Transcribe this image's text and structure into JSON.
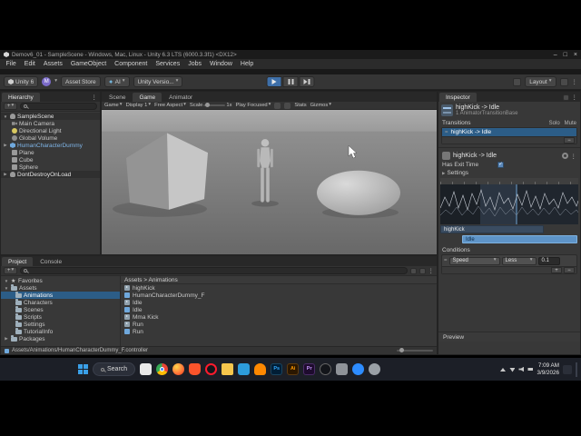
{
  "glyphs": {
    "caret": "▾",
    "fold_open": "▼",
    "fold_closed": "▶",
    "dots": "⋮",
    "check": "✓",
    "star": "★",
    "plus": "+",
    "minus": "−",
    "equals": "=",
    "minimize": "–",
    "maximize": "□",
    "close": "×"
  },
  "titlebar": {
    "title": "Demov6_01 - SampleScene - Windows, Mac, Linux - Unity 6.3 LTS (6000.3.3f1) <DX12>"
  },
  "menubar": {
    "items": [
      "File",
      "Edit",
      "Assets",
      "GameObject",
      "Component",
      "Services",
      "Jobs",
      "Window",
      "Help"
    ]
  },
  "toolbar": {
    "unity_badge": "Unity 6",
    "account": "M",
    "asset_store": "Asset Store",
    "ai": "AI",
    "version": "Unity Versio...",
    "layout": "Layout"
  },
  "hierarchy": {
    "tab": "Hierarchy",
    "scene": "SampleScene",
    "items": [
      "Main Camera",
      "Directional Light",
      "Global Volume",
      "HumanCharacterDummy",
      "Plane",
      "Cube",
      "Sphere"
    ],
    "dont_destroy": "DontDestroyOnLoad"
  },
  "gameview": {
    "tabs": [
      "Scene",
      "Game",
      "Animator"
    ],
    "menu": "Game",
    "display": "Display 1",
    "aspect": "Free Aspect",
    "scale_label": "Scale",
    "scale_value": "1x",
    "play_focused": "Play Focused",
    "stats": "Stats",
    "gizmos": "Gizmos"
  },
  "inspector": {
    "tab": "Inspector",
    "header": {
      "title": "highKick -> Idle",
      "subtitle": "1 AnimatorTransitionBase"
    },
    "transitions_label": "Transitions",
    "solo": "Solo",
    "mute": "Mute",
    "transition_item": "highKick -> Idle",
    "state_title": "highKick -> Idle",
    "has_exit_time": "Has Exit Time",
    "settings": "Settings",
    "bar_from": "highKick",
    "bar_to": "Idle",
    "conditions_label": "Conditions",
    "cond_param": "Speed",
    "cond_op": "Less",
    "cond_value": "0.1",
    "preview": "Preview"
  },
  "project": {
    "tabs": [
      "Project",
      "Console"
    ],
    "favorites": "Favorites",
    "root": "Assets",
    "folders": [
      "Animations",
      "Characters",
      "Scenes",
      "Scripts",
      "Settings",
      "TutorialInfo"
    ],
    "packages": "Packages",
    "breadcrumb": "Assets > Animations",
    "files": [
      "highKick",
      "HumanCharacterDummy_F",
      "Idle",
      "Idle",
      "Mma Kick",
      "Run",
      "Run"
    ],
    "status": "Assets/Animations/HumanCharacterDummy_F.controller"
  },
  "taskbar": {
    "search": "Search",
    "ps": "Ps",
    "ai": "Ai",
    "pr": "Pr",
    "time": "7:09 AM",
    "date": "3/9/2026"
  },
  "theme": {
    "accent": "#3A79BB",
    "selection": "#2C5D87",
    "play_active": "#3E6FA8"
  }
}
